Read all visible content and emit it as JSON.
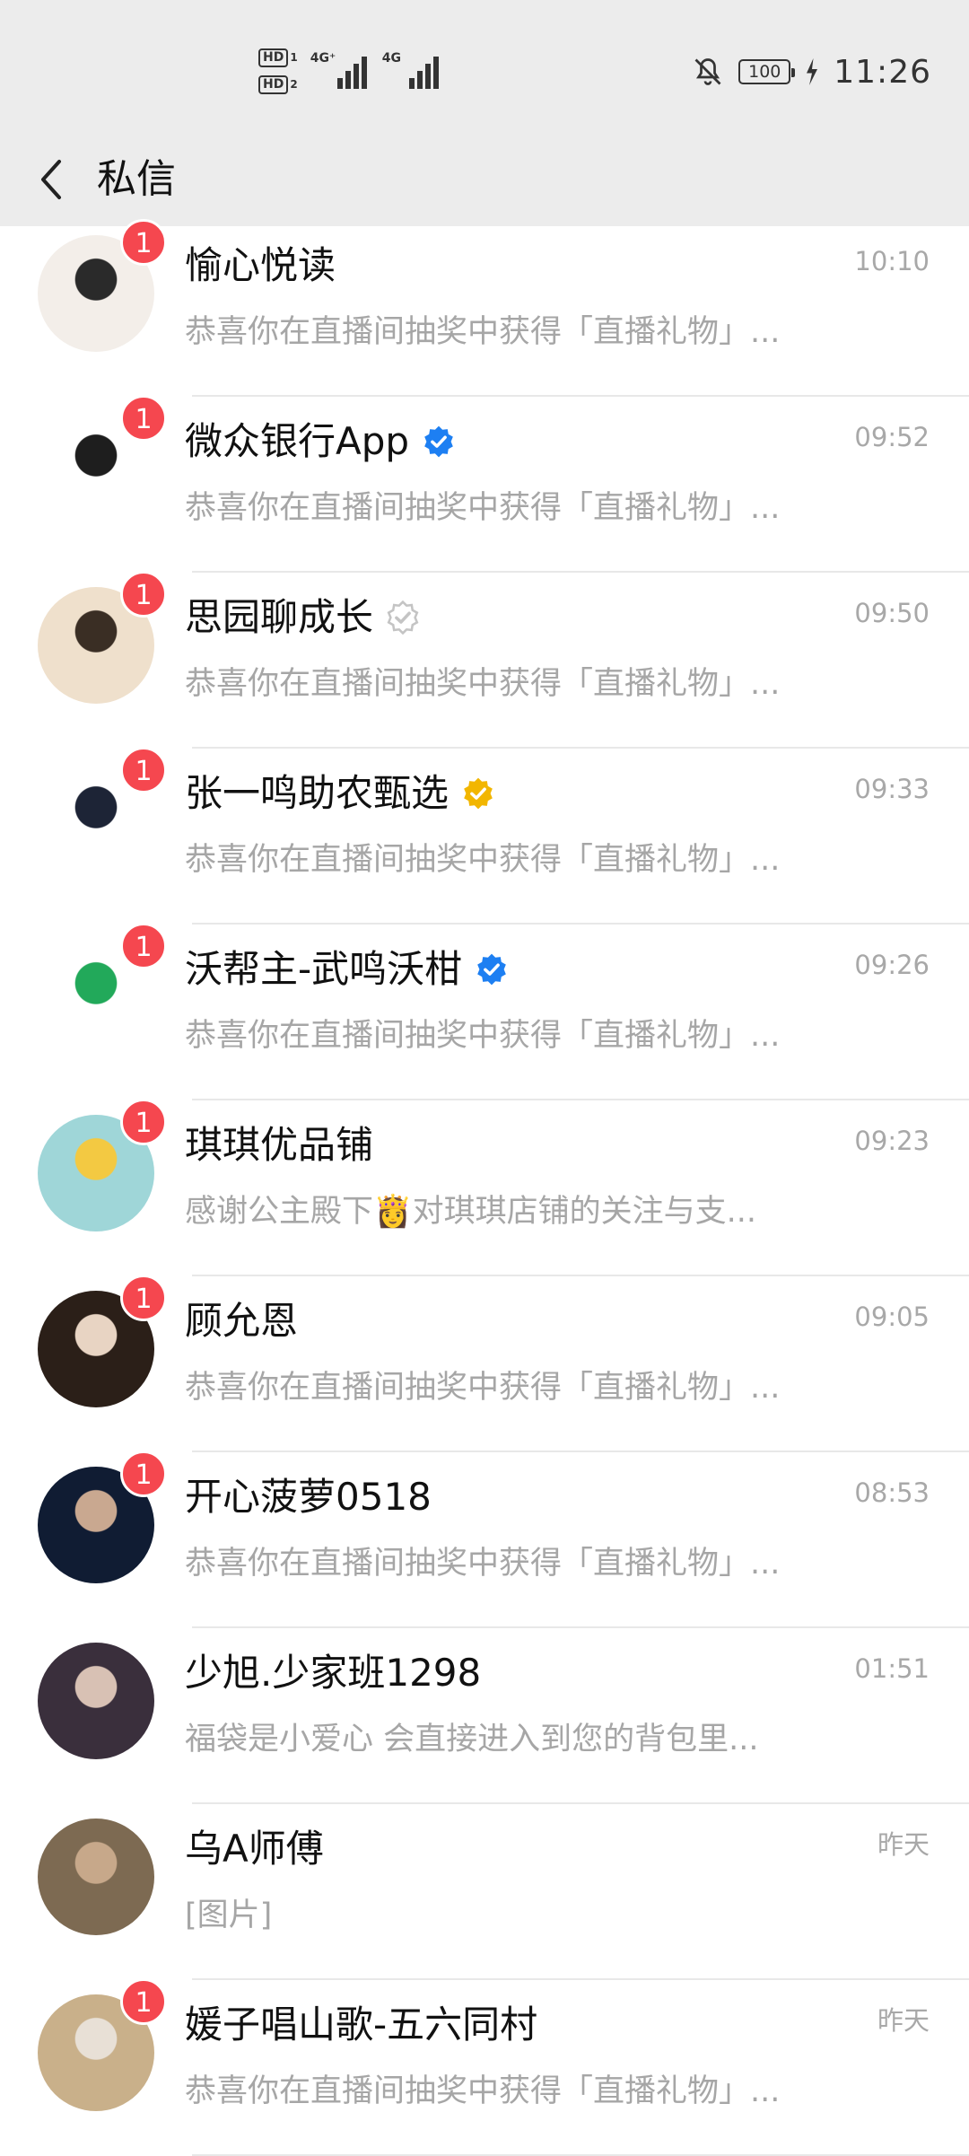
{
  "status": {
    "hd1": "HD",
    "hd1_sub": "1",
    "hd2": "HD",
    "hd2_sub": "2",
    "net1": "4G⁺",
    "net2": "4G",
    "battery": "100",
    "time": "11:26"
  },
  "header": {
    "title": "私信",
    "icons": [
      "back-arrow-icon"
    ]
  },
  "conversations": [
    {
      "name": "愉心悦读",
      "time": "10:10",
      "preview": "恭喜你在直播间抽奖中获得「直播礼物」...",
      "unread": "1",
      "verified": "",
      "avatar_colors": [
        "#f3eee9",
        "#2a2a2a"
      ]
    },
    {
      "name": "微众银行App",
      "time": "09:52",
      "preview": "恭喜你在直播间抽奖中获得「直播礼物」...",
      "unread": "1",
      "verified": "blue",
      "avatar_colors": [
        "#ffffff",
        "#1e1e1e"
      ]
    },
    {
      "name": "思园聊成长",
      "time": "09:50",
      "preview": "恭喜你在直播间抽奖中获得「直播礼物」...",
      "unread": "1",
      "verified": "gray",
      "avatar_colors": [
        "#efe0cc",
        "#3a2e24"
      ]
    },
    {
      "name": "张一鸣助农甄选",
      "time": "09:33",
      "preview": "恭喜你在直播间抽奖中获得「直播礼物」...",
      "unread": "1",
      "verified": "gold",
      "avatar_colors": [
        "#ffffff",
        "#1d2436"
      ]
    },
    {
      "name": "沃帮主-武鸣沃柑",
      "time": "09:26",
      "preview": "恭喜你在直播间抽奖中获得「直播礼物」...",
      "unread": "1",
      "verified": "blue",
      "avatar_colors": [
        "#ffffff",
        "#22a95a"
      ]
    },
    {
      "name": "琪琪优品铺",
      "time": "09:23",
      "preview": "感谢公主殿下👸对琪琪店铺的关注与支...",
      "unread": "1",
      "verified": "",
      "avatar_colors": [
        "#9fd6d8",
        "#f3c942"
      ]
    },
    {
      "name": "顾允恩",
      "time": "09:05",
      "preview": "恭喜你在直播间抽奖中获得「直播礼物」...",
      "unread": "1",
      "verified": "",
      "avatar_colors": [
        "#2b1f18",
        "#e8d4c3"
      ]
    },
    {
      "name": "开心菠萝0518",
      "time": "08:53",
      "preview": "恭喜你在直播间抽奖中获得「直播礼物」...",
      "unread": "1",
      "verified": "",
      "avatar_colors": [
        "#101c33",
        "#c9a890"
      ]
    },
    {
      "name": "少旭.少家班1298",
      "time": "01:51",
      "preview": "福袋是小爱心 会直接进入到您的背包里...",
      "unread": "",
      "verified": "",
      "avatar_colors": [
        "#3a2f3c",
        "#d8c1b4"
      ]
    },
    {
      "name": "乌A师傅",
      "time": "昨天",
      "preview": "[图片]",
      "unread": "",
      "verified": "",
      "avatar_colors": [
        "#7d6a52",
        "#c7a88a"
      ]
    },
    {
      "name": "媛子唱山歌-五六同村",
      "time": "昨天",
      "preview": "恭喜你在直播间抽奖中获得「直播礼物」...",
      "unread": "1",
      "verified": "",
      "avatar_colors": [
        "#c9b08a",
        "#e8e0d6"
      ]
    }
  ]
}
